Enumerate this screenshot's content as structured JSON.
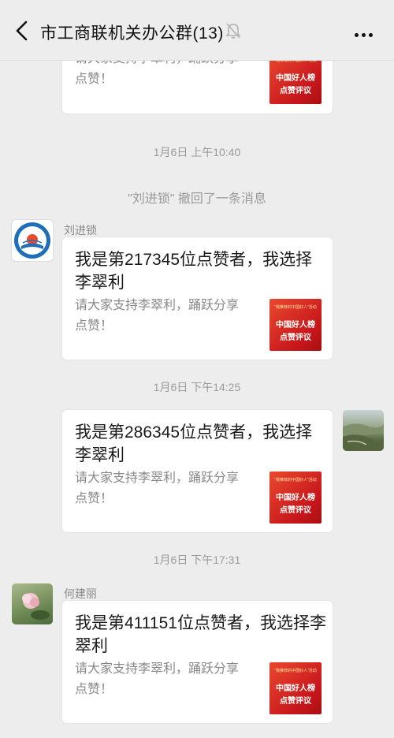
{
  "header": {
    "title": "市工商联机关办公群(13)",
    "back_icon": "chevron-left-icon",
    "mute_icon": "bell-off-icon",
    "more_icon": "ellipsis-icon"
  },
  "share_card": {
    "desc_line1": "请大家支持李翠利，踊跃分享",
    "desc_line2": "点赞！",
    "thumb_line1": "\"我推荐的中国好人\"活动",
    "thumb_line2": "中国好人榜",
    "thumb_line3": "点赞评议"
  },
  "messages": [
    {
      "type": "card-partial"
    },
    {
      "type": "timestamp",
      "text": "1月6日 上午10:40"
    },
    {
      "type": "system",
      "text": "\"刘进锁\" 撤回了一条消息"
    },
    {
      "type": "card",
      "side": "left",
      "sender": "刘进锁",
      "headline": "我是第217345位点赞者，我选择李翠利"
    },
    {
      "type": "timestamp",
      "text": "1月6日 下午14:25"
    },
    {
      "type": "card",
      "side": "right",
      "headline": "我是第286345位点赞者，我选择李翠利"
    },
    {
      "type": "timestamp",
      "text": "1月6日 下午17:31"
    },
    {
      "type": "card",
      "side": "left",
      "sender": "何建丽",
      "headline": "我是第411151位点赞者，我选择李翠利"
    }
  ],
  "colors": {
    "background": "#ededed",
    "card": "#ffffff",
    "thumb_red": "#d21f1f",
    "muted_text": "#9a9a9a"
  }
}
